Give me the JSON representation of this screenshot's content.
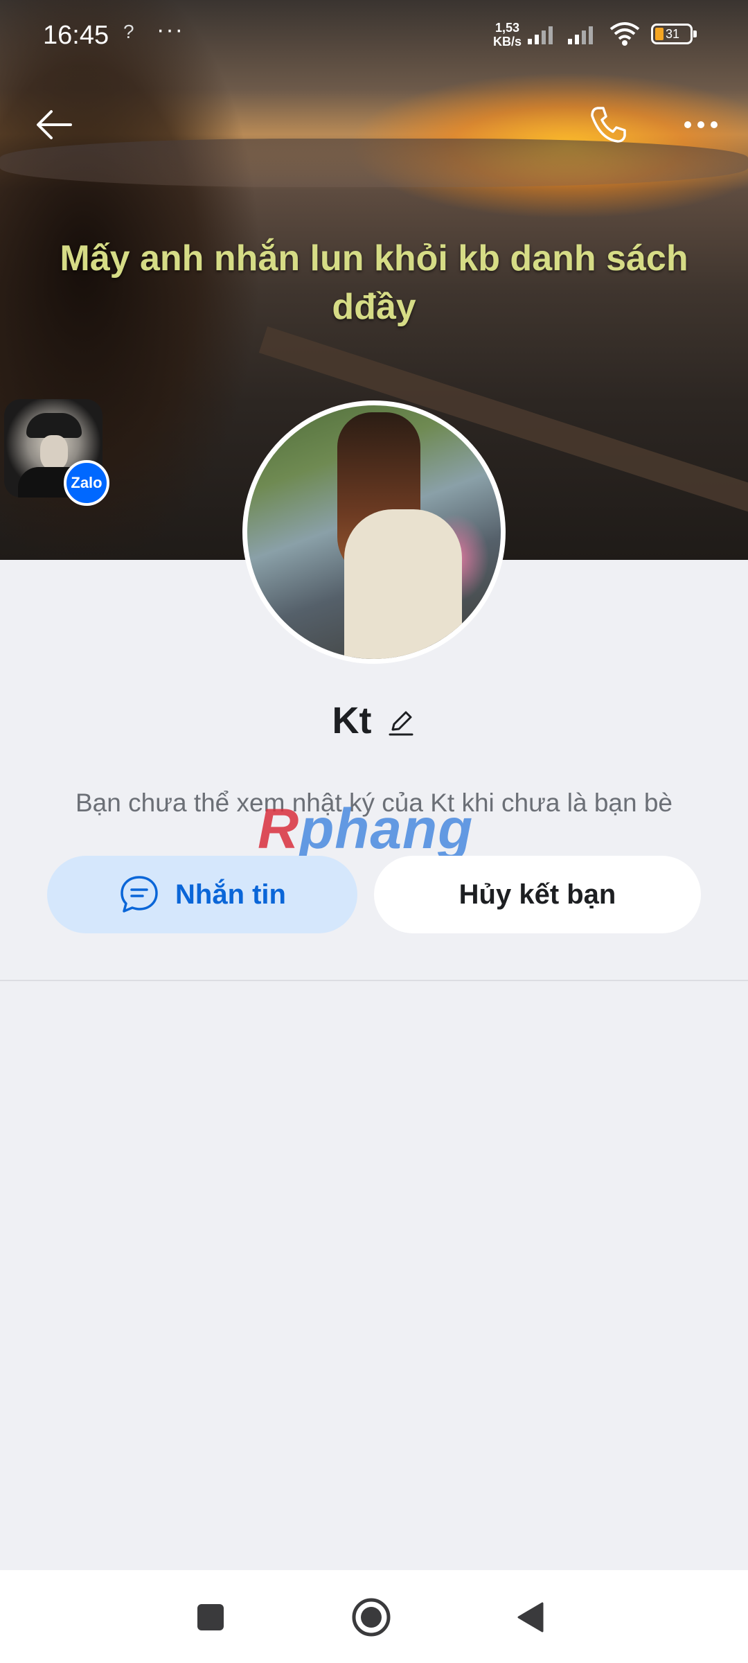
{
  "status_bar": {
    "time": "16:45",
    "signal_extra": "?",
    "more": "···",
    "net_speed_value": "1,53",
    "net_speed_unit": "KB/s",
    "battery": "31"
  },
  "cover": {
    "caption": "Mấy anh nhắn lun khỏi kb danh sách dđầy",
    "app_badge": "Zalo"
  },
  "profile": {
    "name": "Kt",
    "notice": "Bạn chưa thể xem nhật ký của Kt khi chưa là bạn bè"
  },
  "watermark": {
    "part1": "R",
    "part2": "phang"
  },
  "actions": {
    "message_label": "Nhắn tin",
    "unfriend_label": "Hủy kết bạn"
  },
  "colors": {
    "background": "#eff0f4",
    "accent": "#0a66d8",
    "message_button_bg": "#d5e7fc",
    "cover_text": "#d6dc86"
  },
  "icons": [
    "back-arrow-icon",
    "phone-icon",
    "more-dots-icon",
    "edit-pencil-icon",
    "chat-bubble-icon",
    "nav-recent-icon",
    "nav-home-icon",
    "nav-back-icon"
  ]
}
